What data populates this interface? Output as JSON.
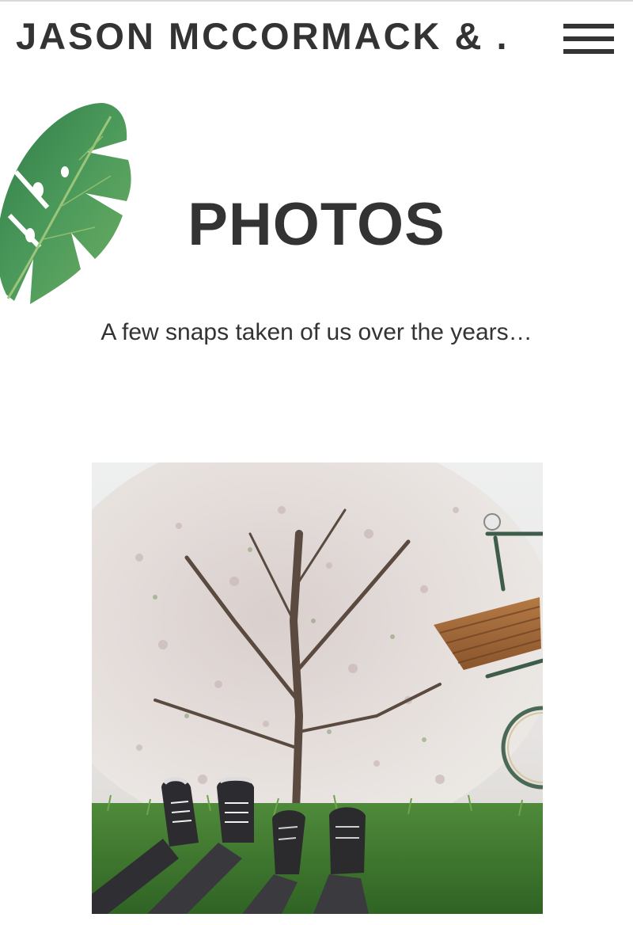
{
  "header": {
    "site_title": "JASON MCCORMACK & ...",
    "menu_icon": "hamburger-menu-icon"
  },
  "decoration": {
    "leaf_icon": "monstera-leaf-illustration"
  },
  "main": {
    "title": "PHOTOS",
    "subtitle": "A few snaps taken of us over the years…"
  },
  "gallery": {
    "photos": [
      {
        "subject": "two pairs of sneakers on grass under blossoming tree with bicycle"
      }
    ]
  },
  "colors": {
    "text": "#333333",
    "background": "#ffffff",
    "leaf_green": "#3f8f55"
  }
}
